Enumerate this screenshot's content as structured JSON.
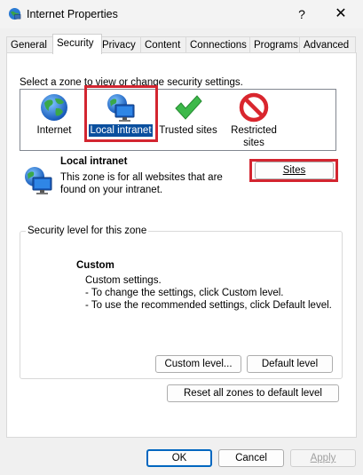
{
  "window": {
    "title": "Internet Properties",
    "help_label": "?",
    "close_label": "✕"
  },
  "tabs": [
    {
      "label": "General"
    },
    {
      "label": "Security"
    },
    {
      "label": "Privacy"
    },
    {
      "label": "Content"
    },
    {
      "label": "Connections"
    },
    {
      "label": "Programs"
    },
    {
      "label": "Advanced"
    }
  ],
  "active_tab": "Security",
  "zones": {
    "prompt": "Select a zone to view or change security settings.",
    "items": [
      {
        "label": "Internet",
        "icon": "globe-icon"
      },
      {
        "label": "Local intranet",
        "icon": "intranet-icon",
        "selected": true
      },
      {
        "label": "Trusted sites",
        "icon": "checkmark-icon"
      },
      {
        "label": "Restricted sites",
        "icon": "restricted-icon",
        "line1": "Restricted",
        "line2": "sites"
      }
    ]
  },
  "detail": {
    "title": "Local intranet",
    "description_line1": "This zone is for all websites that are",
    "description_line2": "found on your intranet.",
    "sites_button": "Sites"
  },
  "security_level": {
    "legend": "Security level for this zone",
    "title": "Custom",
    "lines": [
      "Custom settings.",
      "- To change the settings, click Custom level.",
      "- To use the recommended settings, click Default level."
    ],
    "custom_level_button": "Custom level...",
    "default_level_button": "Default level",
    "reset_button": "Reset all zones to default level"
  },
  "footer": {
    "ok": "OK",
    "cancel": "Cancel",
    "apply": "Apply"
  },
  "colors": {
    "highlight_red": "#d32530",
    "selection_blue": "#0a4f9e",
    "default_button_border": "#0067c0"
  }
}
